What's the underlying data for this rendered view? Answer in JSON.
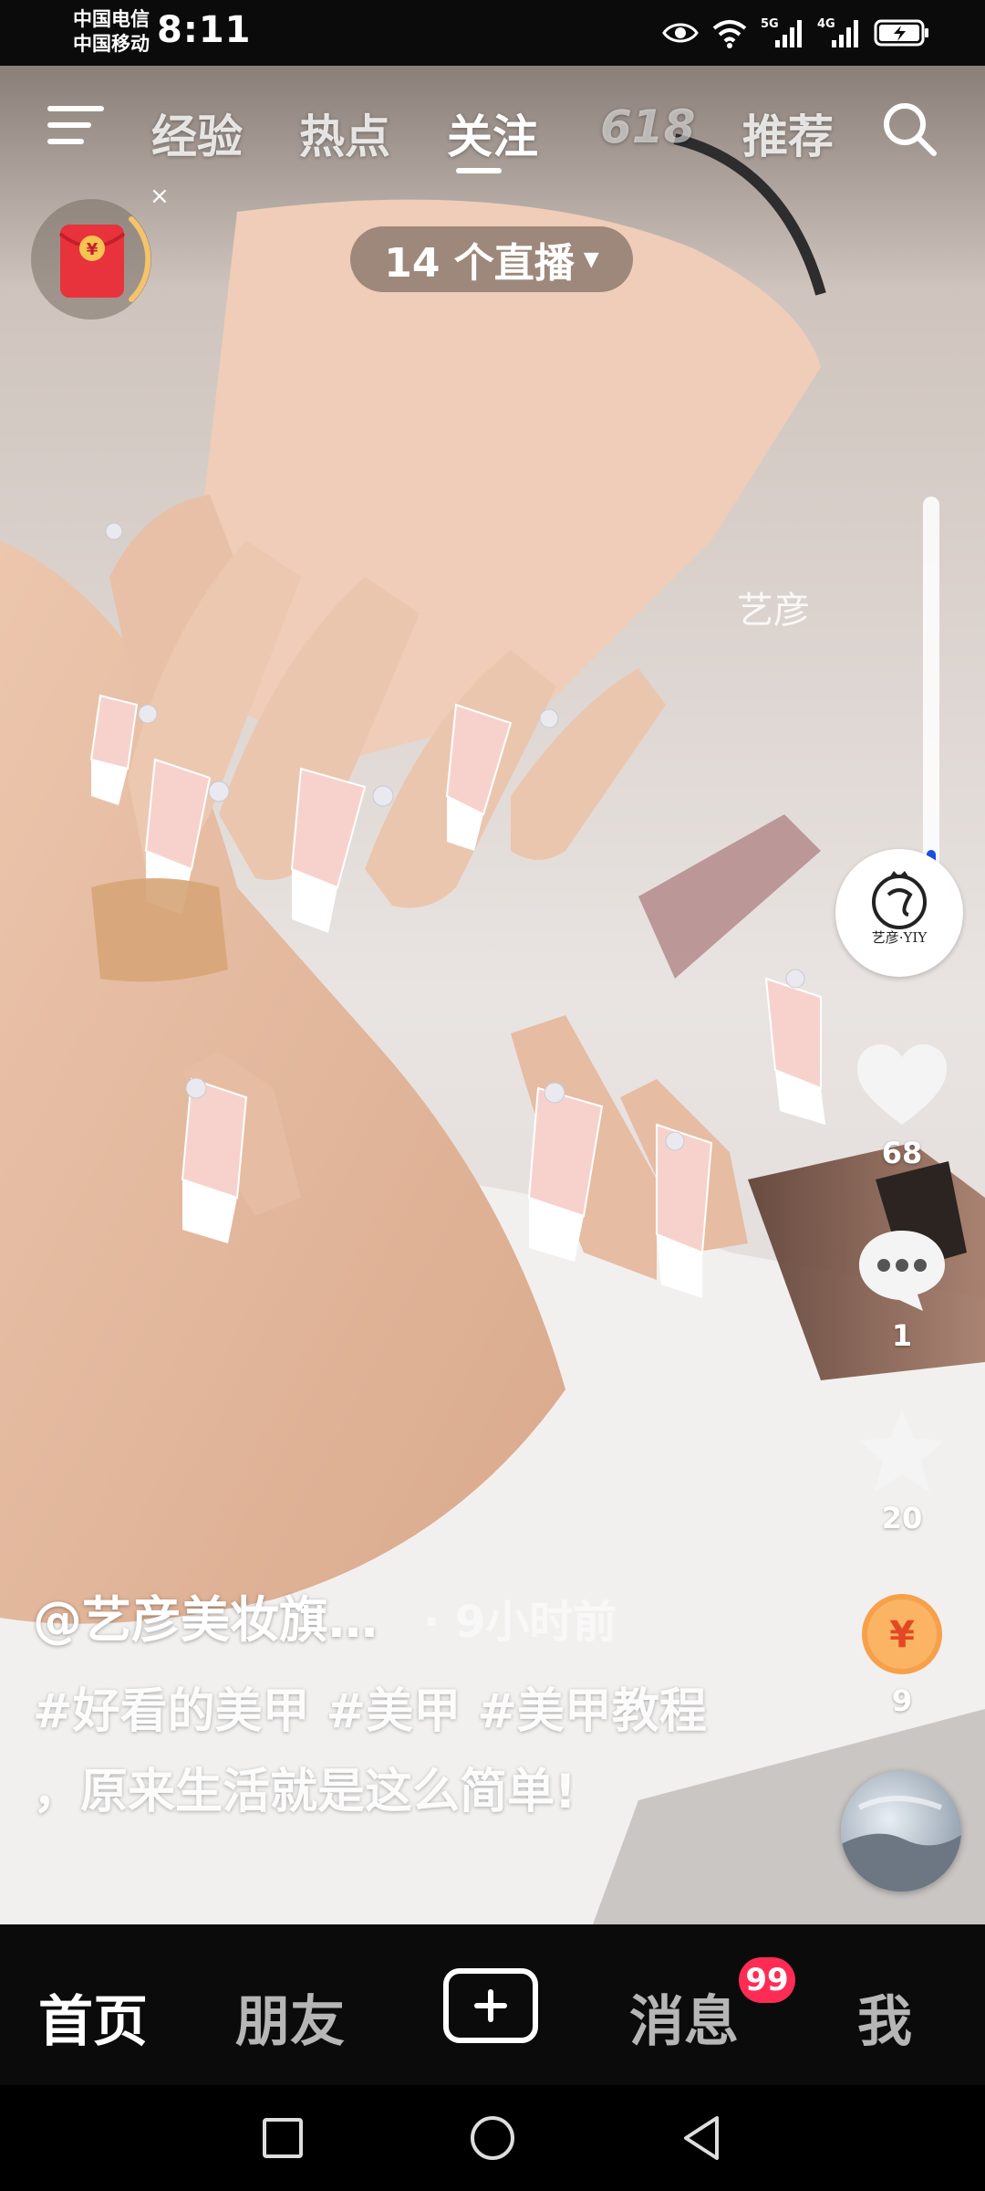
{
  "status_bar": {
    "carrier_1": "中国电信",
    "carrier_2": "中国移动",
    "time": "8:11",
    "icons": [
      "eye-icon",
      "wifi-icon",
      "signal-5g-icon",
      "signal-4g-icon",
      "battery-charging-icon"
    ],
    "network_1": "5G",
    "network_2": "4G"
  },
  "top_nav": {
    "tabs": [
      {
        "label": "经验",
        "active": false
      },
      {
        "label": "热点",
        "active": false
      },
      {
        "label": "关注",
        "active": true
      },
      {
        "label": "618",
        "active": false
      },
      {
        "label": "推荐",
        "active": false
      }
    ],
    "live_pill": "14 个直播",
    "red_packet_symbol": "¥",
    "red_packet_close": "×"
  },
  "video": {
    "watermark": "艺彦",
    "progress": 0.2
  },
  "actions": {
    "avatar_label": "艺彦·YIY",
    "like_count": "68",
    "comment_count": "1",
    "favorite_count": "20",
    "gift_count": "9",
    "gift_symbol": "¥"
  },
  "caption": {
    "author": "@艺彦美妆旗…",
    "time": "· 9小时前",
    "description": "#好看的美甲 #美甲 #美甲教程 ，原来生活就是这么简单!"
  },
  "bottom_nav": {
    "home": "首页",
    "friends": "朋友",
    "messages": "消息",
    "messages_badge": "99",
    "me": "我"
  },
  "colors": {
    "accent_red": "#fe2c55",
    "progress_blue": "#1d4fe0",
    "gift_orange": "#f7a04a"
  }
}
